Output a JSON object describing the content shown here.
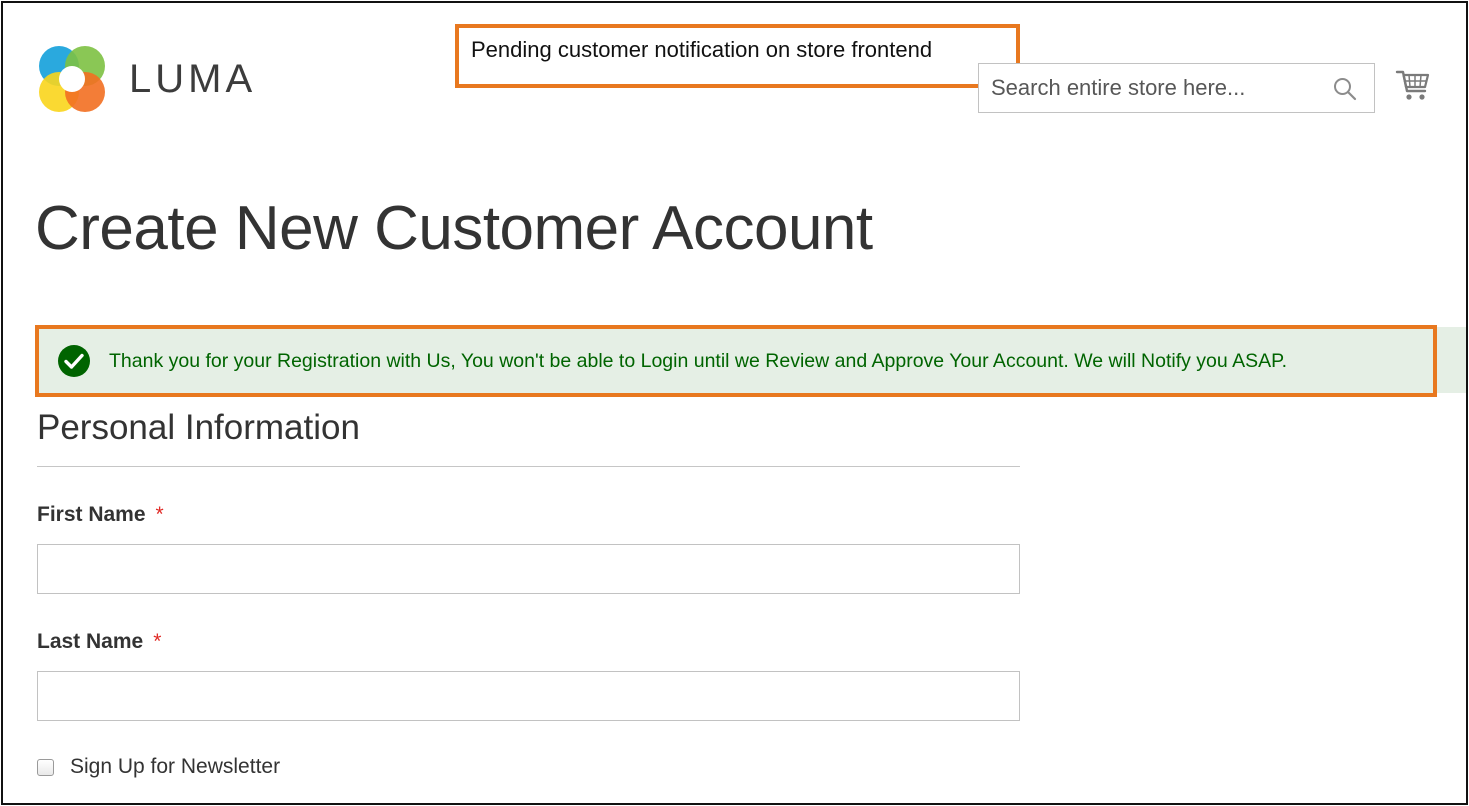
{
  "header": {
    "logo_text": "LUMA",
    "logo_icon": "luma-logo-icon",
    "search": {
      "placeholder": "Search entire store here...",
      "icon": "search-icon"
    },
    "cart_icon": "cart-icon"
  },
  "annotations": {
    "callout_text": "Pending customer notification on store frontend",
    "highlight_color": "#e8781f"
  },
  "page": {
    "title": "Create New Customer Account"
  },
  "message": {
    "type": "success",
    "icon": "checkmark-circle-icon",
    "text": "Thank you for your Registration with Us, You won't be able to Login until we Review and Approve Your Account. We will Notify you ASAP.",
    "text_color": "#006400",
    "background_color": "#e5efe5"
  },
  "form": {
    "section_title": "Personal Information",
    "fields": [
      {
        "label": "First Name",
        "required_marker": "*",
        "value": ""
      },
      {
        "label": "Last Name",
        "required_marker": "*",
        "value": ""
      }
    ],
    "newsletter": {
      "label": "Sign Up for Newsletter",
      "checked": false
    }
  }
}
